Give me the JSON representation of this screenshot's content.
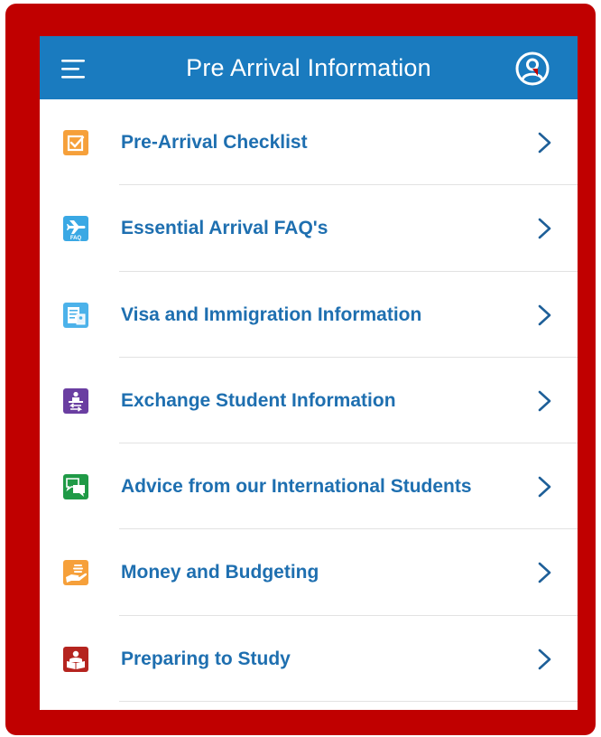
{
  "header": {
    "title": "Pre Arrival Information",
    "menu_icon": "hamburger-menu-icon",
    "profile_icon": "user-profile-icon"
  },
  "colors": {
    "frame": "#c00000",
    "header_bg": "#1a7bbf",
    "label_text": "#1e6fb0",
    "chevron": "#1e5f98"
  },
  "items": [
    {
      "label": "Pre-Arrival Checklist",
      "icon": "checklist-icon",
      "icon_color": "#f6a03a"
    },
    {
      "label": "Essential Arrival FAQ's",
      "icon": "airplane-faq-icon",
      "icon_color": "#3aa8e4"
    },
    {
      "label": "Visa and Immigration Information",
      "icon": "passport-document-icon",
      "icon_color": "#4cb2ea"
    },
    {
      "label": "Exchange Student Information",
      "icon": "exchange-student-icon",
      "icon_color": "#6a3ea1"
    },
    {
      "label": "Advice from our International Students",
      "icon": "chat-bubbles-icon",
      "icon_color": "#1f9a46"
    },
    {
      "label": "Money and Budgeting",
      "icon": "money-hand-icon",
      "icon_color": "#f6a03a"
    },
    {
      "label": "Preparing to Study",
      "icon": "reading-student-icon",
      "icon_color": "#b5241f"
    }
  ]
}
